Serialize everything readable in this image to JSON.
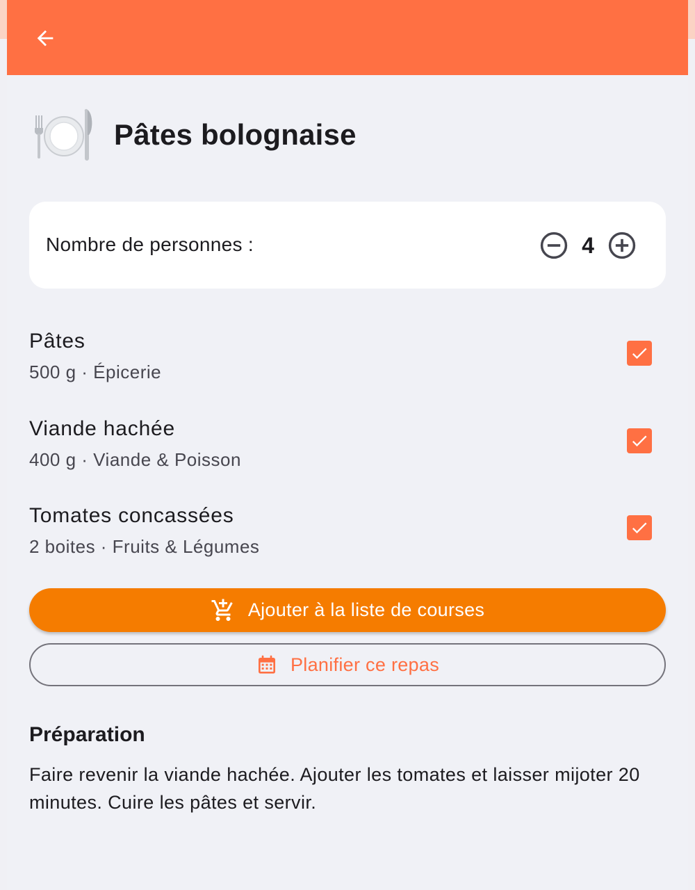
{
  "app": {
    "back_icon": "arrow-back-icon",
    "dish_icon": "fork-knife-plate-icon",
    "title": "Pâtes bolognaise",
    "colors": {
      "primary": "#ff7043",
      "button": "#f57c00",
      "background": "#f0f1f6"
    }
  },
  "servings": {
    "label": "Nombre de personnes :",
    "count": "4",
    "decrement_icon": "remove-circle-outline-icon",
    "increment_icon": "add-circle-outline-icon"
  },
  "ingredients": [
    {
      "name": "Pâtes",
      "detail": "500 g · Épicerie",
      "checked": true
    },
    {
      "name": "Viande hachée",
      "detail": "400 g · Viande & Poisson",
      "checked": true
    },
    {
      "name": "Tomates concassées",
      "detail": "2 boites · Fruits & Légumes",
      "checked": true
    }
  ],
  "actions": {
    "add_to_list": {
      "label": "Ajouter à la liste de courses",
      "icon": "add-shopping-cart-icon"
    },
    "plan_meal": {
      "label": "Planifier ce repas",
      "icon": "calendar-icon"
    }
  },
  "preparation": {
    "title": "Préparation",
    "text": "Faire revenir la viande hachée. Ajouter les tomates et laisser mijoter 20 minutes. Cuire les pâtes et servir."
  }
}
